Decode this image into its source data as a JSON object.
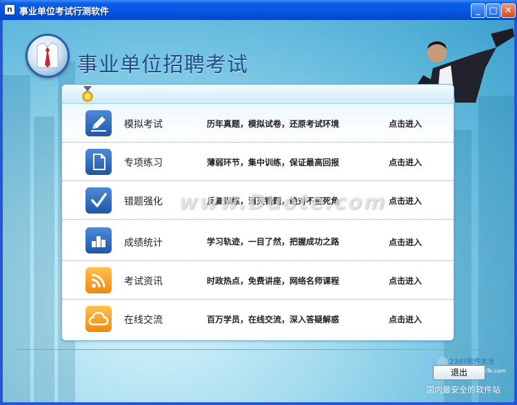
{
  "window": {
    "title": "事业单位考试行测软件",
    "minimize_label": "_",
    "maximize_label": "□",
    "close_label": "✕"
  },
  "header": {
    "heading": "事业单位招聘考试"
  },
  "menu": {
    "items": [
      {
        "title": "模拟考试",
        "desc": "历年真题，模拟试卷，还原考试环境",
        "enter": "点击进入",
        "icon": "pencil-icon",
        "color": "#2f6ab5"
      },
      {
        "title": "专项练习",
        "desc": "薄弱环节，集中训练，保证最高回报",
        "enter": "点击进入",
        "icon": "document-icon",
        "color": "#2f6ab5"
      },
      {
        "title": "错题强化",
        "desc": "反复训练，消灭错题，绝对不留死角",
        "enter": "点击进入",
        "icon": "checkmark-icon",
        "color": "#2f6ab5"
      },
      {
        "title": "成绩统计",
        "desc": "学习轨迹，一目了然，把握成功之路",
        "enter": "点击进入",
        "icon": "bar-chart-icon",
        "color": "#2f6ab5"
      },
      {
        "title": "考试资讯",
        "desc": "时政热点，免费讲座，网络名师课程",
        "enter": "点击进入",
        "icon": "rss-icon",
        "color": "#f29a1c"
      },
      {
        "title": "在线交流",
        "desc": "百万学员，在线交流，深入答疑解惑",
        "enter": "点击进入",
        "icon": "cloud-icon",
        "color": "#f29a1c"
      }
    ]
  },
  "watermark": "www.Duote.com",
  "footer": {
    "exit_label": "退出",
    "site_slogan": "国内最安全的软件站",
    "site_logo_text": "2345软件大全",
    "site_logo_url_text": "www.DuoTe.com"
  }
}
